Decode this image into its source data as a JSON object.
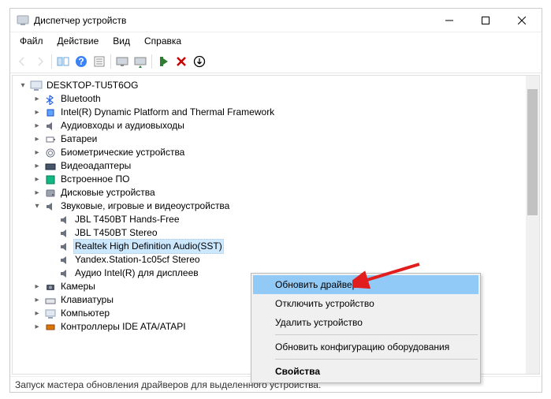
{
  "window": {
    "title": "Диспетчер устройств"
  },
  "menu": {
    "file": "Файл",
    "action": "Действие",
    "view": "Вид",
    "help": "Справка"
  },
  "tree": {
    "root": "DESKTOP-TU5T6OG",
    "bluetooth": "Bluetooth",
    "intel_dptf": "Intel(R) Dynamic Platform and Thermal Framework",
    "audio_io": "Аудиовходы и аудиовыходы",
    "batteries": "Батареи",
    "biometric": "Биометрические устройства",
    "video_adapters": "Видеоадаптеры",
    "firmware": "Встроенное ПО",
    "disk_drives": "Дисковые устройства",
    "sound_game_video": "Звуковые, игровые и видеоустройства",
    "jbl_hf": "JBL T450BT Hands-Free",
    "jbl_stereo": "JBL T450BT Stereo",
    "realtek": "Realtek High Definition Audio(SST)",
    "yandex": "Yandex.Station-1c05cf Stereo",
    "intel_audio": "Аудио Intel(R) для дисплеев",
    "cameras": "Камеры",
    "keyboards": "Клавиатуры",
    "computer": "Компьютер",
    "ide_atapi": "Контроллеры IDE ATA/ATAPI"
  },
  "context_menu": {
    "update_driver": "Обновить драйвер",
    "disable_device": "Отключить устройство",
    "remove_device": "Удалить устройство",
    "scan_hw": "Обновить конфигурацию оборудования",
    "properties": "Свойства"
  },
  "statusbar": {
    "text": "Запуск мастера обновления драйверов для выделенного устройства."
  }
}
